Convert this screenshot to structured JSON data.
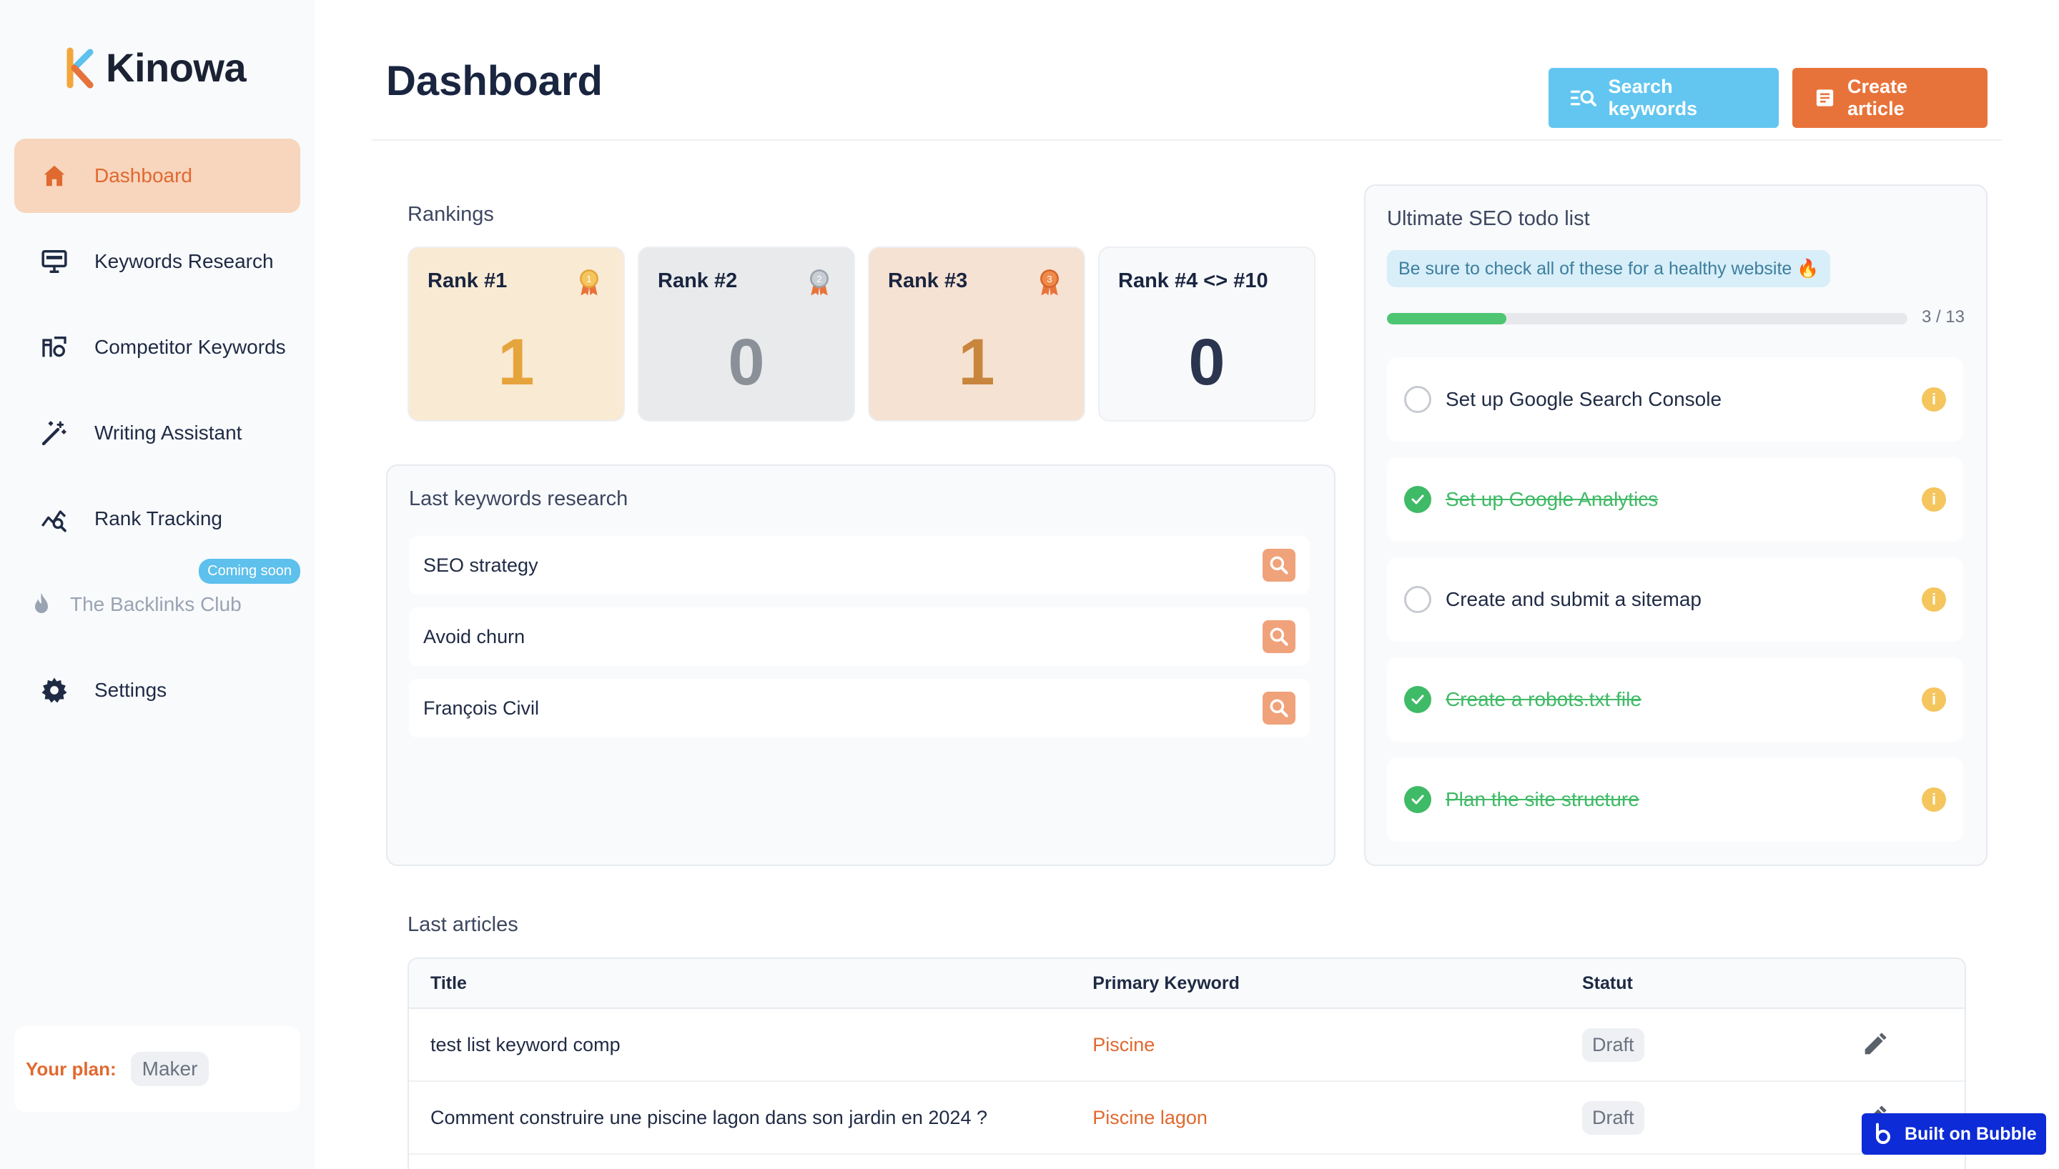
{
  "app": {
    "name": "Kinowa",
    "accent": "#e0692f"
  },
  "sidebar": {
    "items": [
      {
        "label": "Dashboard",
        "icon": "home-icon"
      },
      {
        "label": "Keywords Research",
        "icon": "monitor-icon"
      },
      {
        "label": "Competitor Keywords",
        "icon": "competitor-icon"
      },
      {
        "label": "Writing Assistant",
        "icon": "magic-wand-icon"
      },
      {
        "label": "Rank Tracking",
        "icon": "chart-search-icon"
      },
      {
        "label": "The Backlinks Club",
        "icon": "flame-icon",
        "badge": "Coming soon"
      },
      {
        "label": "Settings",
        "icon": "gear-icon"
      }
    ],
    "plan_label": "Your plan:",
    "plan_value": "Maker"
  },
  "header": {
    "title": "Dashboard",
    "search_button": "Search keywords",
    "create_button": "Create article"
  },
  "rankings": {
    "label": "Rankings",
    "cards": [
      {
        "title": "Rank #1",
        "value": "1",
        "bg": "#f9ead3",
        "color": "#e6a43c",
        "icon": "gold-medal-icon"
      },
      {
        "title": "Rank #2",
        "value": "0",
        "bg": "#e8eaeb",
        "color": "#8a9098",
        "icon": "silver-medal-icon"
      },
      {
        "title": "Rank #3",
        "value": "1",
        "bg": "#f6e2d2",
        "color": "#c8853d",
        "icon": "bronze-medal-icon"
      },
      {
        "title": "Rank #4 <> #10",
        "value": "0",
        "bg": "#f7f9fb",
        "color": "#2b3550"
      }
    ]
  },
  "keywords_research": {
    "title": "Last keywords research",
    "items": [
      "SEO strategy",
      "Avoid churn",
      "François Civil"
    ]
  },
  "todo": {
    "title": "Ultimate SEO todo list",
    "tip": "Be sure to check all of these for a healthy website 🔥",
    "progress_text": "3 / 13",
    "progress": 0.23,
    "items": [
      {
        "label": "Set up Google Search Console",
        "done": false
      },
      {
        "label": "Set up Google Analytics",
        "done": true
      },
      {
        "label": "Create and submit a sitemap",
        "done": false
      },
      {
        "label": "Create a robots.txt file",
        "done": true
      },
      {
        "label": "Plan the site structure",
        "done": true
      }
    ]
  },
  "articles": {
    "label": "Last articles",
    "columns": [
      "Title",
      "Primary Keyword",
      "Statut"
    ],
    "rows": [
      {
        "title": "test list keyword comp",
        "keyword": "Piscine",
        "status": "Draft"
      },
      {
        "title": "Comment construire une piscine lagon dans son jardin en 2024 ?",
        "keyword": "Piscine lagon",
        "status": "Draft"
      }
    ]
  },
  "bubble_badge": "Built on Bubble"
}
